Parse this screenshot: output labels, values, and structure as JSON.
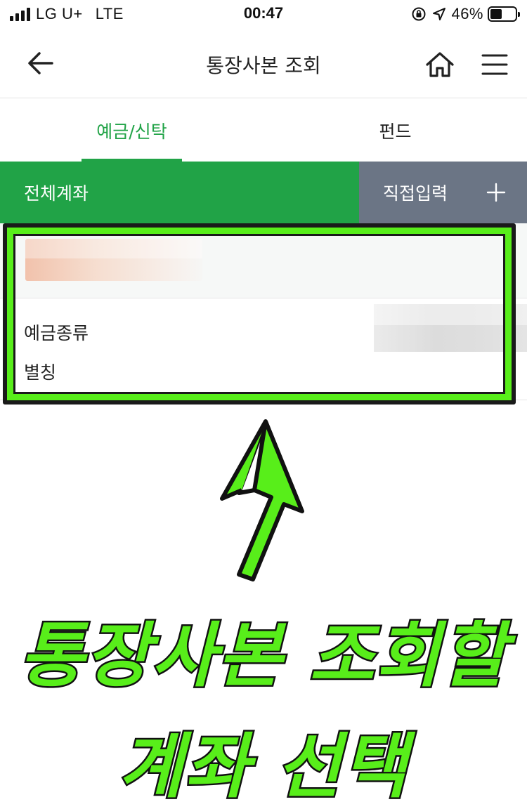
{
  "status_bar": {
    "carrier": "LG U+",
    "network": "LTE",
    "time": "00:47",
    "battery": "46%",
    "battery_level": 0.46,
    "icons": [
      "signal-icon",
      "rotation-lock-icon",
      "location-icon",
      "battery-icon"
    ]
  },
  "header": {
    "title": "통장사본 조회",
    "icons": [
      "back-arrow-icon",
      "home-icon",
      "menu-icon"
    ]
  },
  "tabs": [
    {
      "label": "예금/신탁",
      "active": true
    },
    {
      "label": "펀드",
      "active": false
    }
  ],
  "subtabs": {
    "all_accounts": "전체계좌",
    "direct_input": "직접입력",
    "direct_input_icon": "plus-icon"
  },
  "account": {
    "type_label": "예금종류",
    "alias_label": "별칭"
  },
  "annotation": {
    "line1": "통장사본 조회할",
    "line2": "계좌 선택"
  },
  "colors": {
    "accent_green": "#21a347",
    "subtab_gray": "#6b7585",
    "annotation_green": "#58ee1a"
  }
}
